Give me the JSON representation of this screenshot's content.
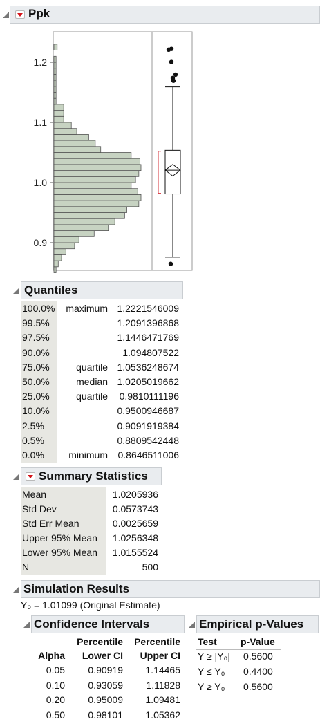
{
  "ppk": {
    "title": "Ppk",
    "y_ticks": [
      "1.2",
      "1.1",
      "1.0",
      "0.9"
    ],
    "histogram_bins": [
      {
        "lo": 0.85,
        "hi": 0.86,
        "count": 2
      },
      {
        "lo": 0.86,
        "hi": 0.87,
        "count": 4
      },
      {
        "lo": 0.87,
        "hi": 0.88,
        "count": 7
      },
      {
        "lo": 0.88,
        "hi": 0.89,
        "count": 11
      },
      {
        "lo": 0.89,
        "hi": 0.9,
        "count": 19
      },
      {
        "lo": 0.9,
        "hi": 0.91,
        "count": 23
      },
      {
        "lo": 0.91,
        "hi": 0.92,
        "count": 37
      },
      {
        "lo": 0.92,
        "hi": 0.93,
        "count": 50
      },
      {
        "lo": 0.93,
        "hi": 0.94,
        "count": 56
      },
      {
        "lo": 0.94,
        "hi": 0.95,
        "count": 65
      },
      {
        "lo": 0.95,
        "hi": 0.96,
        "count": 67
      },
      {
        "lo": 0.96,
        "hi": 0.97,
        "count": 78
      },
      {
        "lo": 0.97,
        "hi": 0.98,
        "count": 80
      },
      {
        "lo": 0.98,
        "hi": 0.99,
        "count": 77
      },
      {
        "lo": 0.99,
        "hi": 1.0,
        "count": 71
      },
      {
        "lo": 1.0,
        "hi": 1.01,
        "count": 75
      },
      {
        "lo": 1.01,
        "hi": 1.02,
        "count": 78
      },
      {
        "lo": 1.02,
        "hi": 1.03,
        "count": 80
      },
      {
        "lo": 1.03,
        "hi": 1.04,
        "count": 79
      },
      {
        "lo": 1.04,
        "hi": 1.05,
        "count": 71
      },
      {
        "lo": 1.05,
        "hi": 1.06,
        "count": 43
      },
      {
        "lo": 1.06,
        "hi": 1.07,
        "count": 38
      },
      {
        "lo": 1.07,
        "hi": 1.08,
        "count": 32
      },
      {
        "lo": 1.08,
        "hi": 1.09,
        "count": 21
      },
      {
        "lo": 1.09,
        "hi": 1.1,
        "count": 16
      },
      {
        "lo": 1.1,
        "hi": 1.11,
        "count": 9
      },
      {
        "lo": 1.11,
        "hi": 1.12,
        "count": 9
      },
      {
        "lo": 1.12,
        "hi": 1.13,
        "count": 9
      },
      {
        "lo": 1.13,
        "hi": 1.14,
        "count": 2
      },
      {
        "lo": 1.14,
        "hi": 1.15,
        "count": 2
      },
      {
        "lo": 1.15,
        "hi": 1.16,
        "count": 2
      },
      {
        "lo": 1.16,
        "hi": 1.17,
        "count": 2
      },
      {
        "lo": 1.17,
        "hi": 1.18,
        "count": 2
      },
      {
        "lo": 1.18,
        "hi": 1.19,
        "count": 2
      },
      {
        "lo": 1.19,
        "hi": 1.2,
        "count": 2
      },
      {
        "lo": 1.2,
        "hi": 1.21,
        "count": 2
      },
      {
        "lo": 1.22,
        "hi": 1.23,
        "count": 3
      }
    ],
    "estimate_line": 1.01099,
    "outliers": [
      0.8647,
      1.1693,
      1.1737,
      1.1794,
      1.2005,
      1.2209,
      1.2222
    ]
  },
  "quantiles": {
    "title": "Quantiles",
    "rows": [
      {
        "pct": "100.0%",
        "label": "maximum",
        "value": "1.2221546009"
      },
      {
        "pct": "99.5%",
        "label": "",
        "value": "1.2091396868"
      },
      {
        "pct": "97.5%",
        "label": "",
        "value": "1.1446471769"
      },
      {
        "pct": "90.0%",
        "label": "",
        "value": "1.094807522"
      },
      {
        "pct": "75.0%",
        "label": "quartile",
        "value": "1.0536248674"
      },
      {
        "pct": "50.0%",
        "label": "median",
        "value": "1.0205019662"
      },
      {
        "pct": "25.0%",
        "label": "quartile",
        "value": "0.9810111196"
      },
      {
        "pct": "10.0%",
        "label": "",
        "value": "0.9500946687"
      },
      {
        "pct": "2.5%",
        "label": "",
        "value": "0.9091919384"
      },
      {
        "pct": "0.5%",
        "label": "",
        "value": "0.8809542448"
      },
      {
        "pct": "0.0%",
        "label": "minimum",
        "value": "0.8646511006"
      }
    ]
  },
  "summary": {
    "title": "Summary Statistics",
    "rows": [
      {
        "label": "Mean",
        "value": "1.0205936"
      },
      {
        "label": "Std Dev",
        "value": "0.0573743"
      },
      {
        "label": "Std Err Mean",
        "value": "0.0025659"
      },
      {
        "label": "Upper 95% Mean",
        "value": "1.0256348"
      },
      {
        "label": "Lower 95% Mean",
        "value": "1.0155524"
      },
      {
        "label": "N",
        "value": "500"
      }
    ]
  },
  "simulation": {
    "title": "Simulation Results",
    "estimate_note": "Y₀ = 1.01099 (Original Estimate)"
  },
  "confidence": {
    "title": "Confidence Intervals",
    "headers": {
      "alpha": "Alpha",
      "lower_top": "Percentile",
      "lower_bottom": "Lower CI",
      "upper_top": "Percentile",
      "upper_bottom": "Upper CI"
    },
    "rows": [
      {
        "alpha": "0.05",
        "lower": "0.90919",
        "upper": "1.14465"
      },
      {
        "alpha": "0.10",
        "lower": "0.93059",
        "upper": "1.11828"
      },
      {
        "alpha": "0.20",
        "lower": "0.95009",
        "upper": "1.09481"
      },
      {
        "alpha": "0.50",
        "lower": "0.98101",
        "upper": "1.05362"
      }
    ]
  },
  "pvalues": {
    "title": "Empirical p-Values",
    "headers": {
      "test": "Test",
      "pvalue": "p-Value"
    },
    "rows": [
      {
        "test": "Y ≥ |Y₀|",
        "pvalue": "0.5600"
      },
      {
        "test": "Y ≤ Y₀",
        "pvalue": "0.4400"
      },
      {
        "test": "Y ≥ Y₀",
        "pvalue": "0.5600"
      }
    ]
  },
  "colors": {
    "bar_fill": "#c7d3c2",
    "bar_stroke": "#555555",
    "estimate_line": "#d6303a",
    "header_bg": "#e9ecef",
    "cell_bg": "#e7e7e2"
  }
}
